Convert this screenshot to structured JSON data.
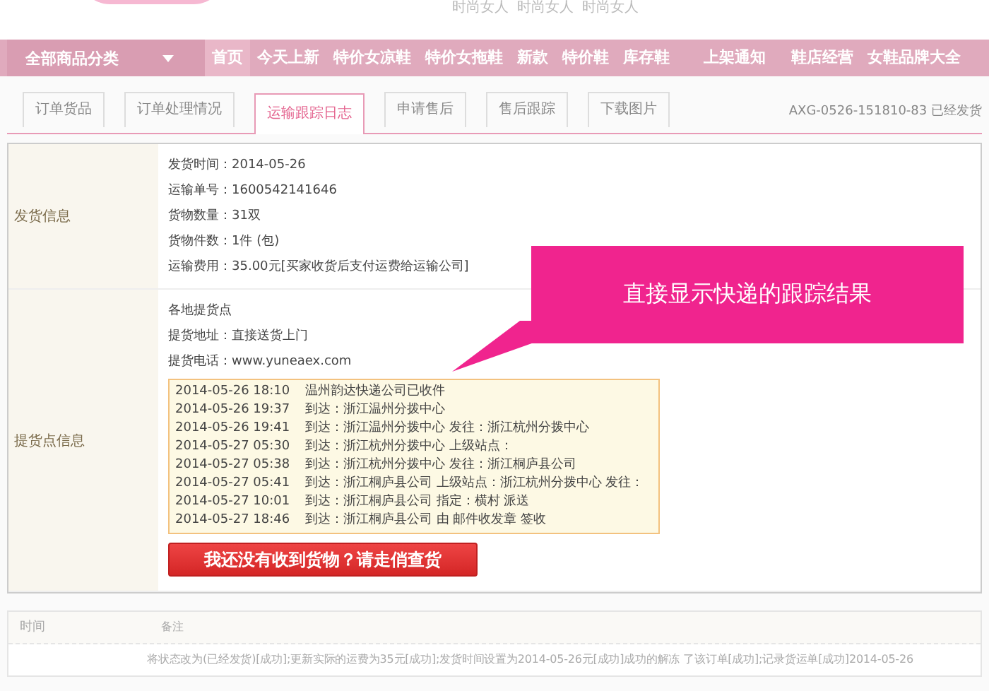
{
  "header": {
    "slogans": [
      "时尚女人",
      "时尚女人",
      "时尚女人"
    ]
  },
  "nav": {
    "category": "全部商品分类",
    "items": [
      {
        "label": "首页",
        "selected": true
      },
      {
        "label": "今天上新",
        "selected": false
      },
      {
        "label": "特价女凉鞋",
        "selected": false
      },
      {
        "label": "特价女拖鞋",
        "selected": false
      },
      {
        "label": "新款",
        "selected": false
      },
      {
        "label": "特价鞋",
        "selected": false
      },
      {
        "label": "库存鞋",
        "selected": false
      },
      {
        "label": "上架通知",
        "selected": false
      },
      {
        "label": "鞋店经营",
        "selected": false
      },
      {
        "label": "女鞋品牌大全",
        "selected": false
      }
    ]
  },
  "tabs": [
    {
      "label": "订单货品",
      "selected": false
    },
    {
      "label": "订单处理情况",
      "selected": false
    },
    {
      "label": "运输跟踪日志",
      "selected": true
    },
    {
      "label": "申请售后",
      "selected": false
    },
    {
      "label": "售后跟踪",
      "selected": false
    },
    {
      "label": "下载图片",
      "selected": false
    }
  ],
  "order_status": "AXG-0526-151810-83 已经发货",
  "shipping": {
    "label": "发货信息",
    "lines": [
      "发货时间：2014-05-26",
      "运输单号：1600542141646",
      "货物数量：31双",
      "货物件数：1件 (包)",
      "运输费用：35.00元[买家收货后支付运费给运输公司]"
    ]
  },
  "pickup": {
    "label": "提货点信息",
    "lines": [
      "各地提货点",
      "提货地址：直接送货上门",
      "提货电话：www.yuneaex.com"
    ],
    "tracking": [
      {
        "time": "2014-05-26 18:10",
        "event": "温州韵达快递公司已收件"
      },
      {
        "time": "2014-05-26 19:37",
        "event": "到达：浙江温州分拨中心"
      },
      {
        "time": "2014-05-26 19:41",
        "event": "到达：浙江温州分拨中心 发往：浙江杭州分拨中心"
      },
      {
        "time": "2014-05-27 05:30",
        "event": "到达：浙江杭州分拨中心 上级站点："
      },
      {
        "time": "2014-05-27 05:38",
        "event": "到达：浙江杭州分拨中心 发往：浙江桐庐县公司"
      },
      {
        "time": "2014-05-27 05:41",
        "event": "到达：浙江桐庐县公司 上级站点：浙江杭州分拨中心 发往："
      },
      {
        "time": "2014-05-27 10:01",
        "event": "到达：浙江桐庐县公司 指定：横村 派送"
      },
      {
        "time": "2014-05-27 18:46",
        "event": "到达：浙江桐庐县公司 由 邮件收发章 签收"
      }
    ],
    "button": "我还没有收到货物？请走俏查货"
  },
  "callout": "直接显示快递的跟踪结果",
  "log": {
    "columns": [
      "时间",
      "备注"
    ],
    "rows": [
      {
        "note": "将状态改为(已经发货)[成功];更新实际的运费为35元[成功];发货时间设置为2014-05-26元[成功]成功的解冻 了该订单[成功];记录货运单[成功]2014-05-26"
      }
    ]
  }
}
